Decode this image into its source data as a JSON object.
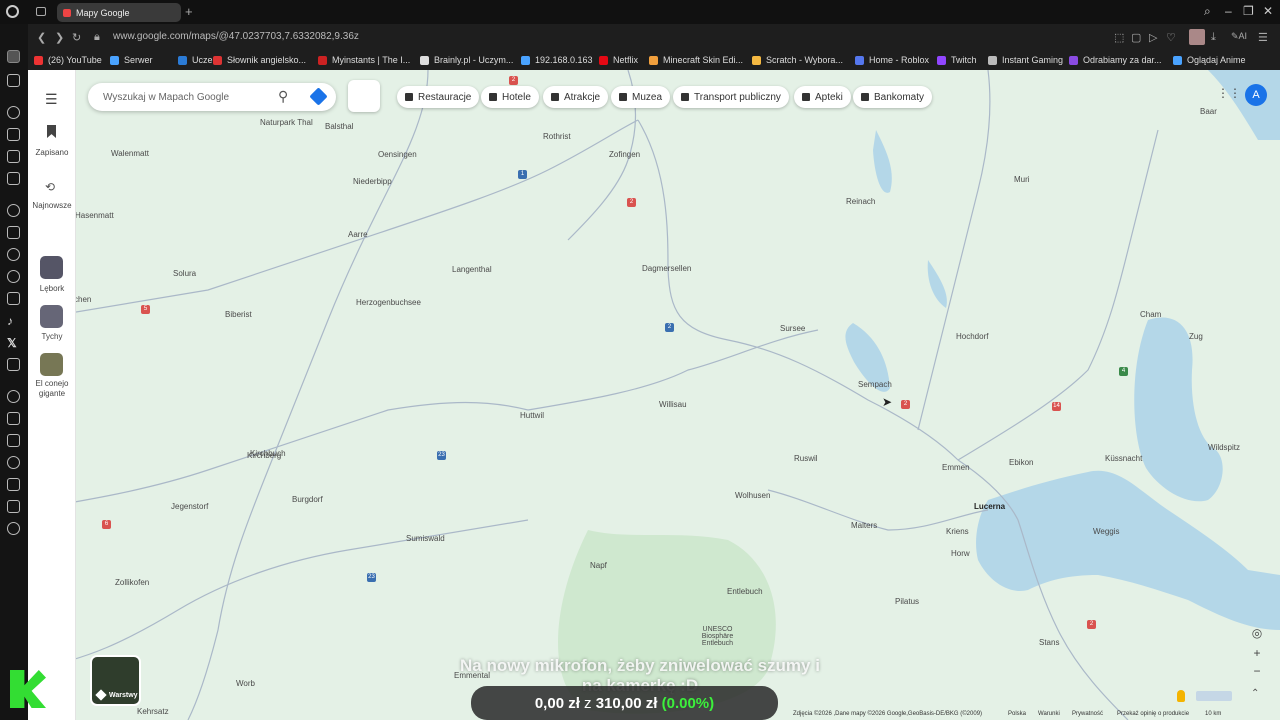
{
  "browser": {
    "tab_title": "Mapy Google",
    "url": "www.google.com/maps/@47.0237703,7.6332082,9.36z",
    "ai_label": "AI",
    "bookmarks": [
      {
        "label": "(26) YouTube",
        "color": "#e33"
      },
      {
        "label": "Serwer",
        "color": "#4aa3ff"
      },
      {
        "label": "Uczeń",
        "color": "#2b7bd6"
      },
      {
        "label": "Słownik angielsko...",
        "color": "#d33"
      },
      {
        "label": "Myinstants | The I...",
        "color": "#c22"
      },
      {
        "label": "Brainly.pl - Uczym...",
        "color": "#ddd"
      },
      {
        "label": "192.168.0.163",
        "color": "#4aa3ff"
      },
      {
        "label": "Netflix",
        "color": "#e50914"
      },
      {
        "label": "Minecraft Skin Edi...",
        "color": "#f2a03d"
      },
      {
        "label": "Scratch - Wybora...",
        "color": "#f5b942"
      },
      {
        "label": "Home - Roblox",
        "color": "#5577ee"
      },
      {
        "label": "Twitch",
        "color": "#9146ff"
      },
      {
        "label": "Instant Gaming",
        "color": "#bbb"
      },
      {
        "label": "Odrabiamy za dar...",
        "color": "#8a4be2"
      },
      {
        "label": "Oglądaj Anime",
        "color": "#4aa3ff"
      }
    ]
  },
  "maps": {
    "search_placeholder": "Wyszukaj w Mapach Google",
    "sidebar": {
      "saved": "Zapisano",
      "recent": "Najnowsze",
      "recent_places": [
        "Lębork",
        "Tychy",
        "El conejo gigante"
      ]
    },
    "chips": [
      "Restauracje",
      "Hotele",
      "Atrakcje",
      "Muzea",
      "Transport publiczny",
      "Apteki",
      "Bankomaty"
    ],
    "avatar_letter": "A",
    "layers_label": "Warstwy",
    "places": [
      {
        "name": "Naturpark Thal"
      },
      {
        "name": "Balsthal"
      },
      {
        "name": "Rothrist"
      },
      {
        "name": "Zofingen"
      },
      {
        "name": "Oensingen"
      },
      {
        "name": "Niederbipp"
      },
      {
        "name": "Walenmatt"
      },
      {
        "name": "Hasenmatt"
      },
      {
        "name": "Aarre"
      },
      {
        "name": "Langenthal"
      },
      {
        "name": "Dagmersellen"
      },
      {
        "name": "Reinach"
      },
      {
        "name": "Muri"
      },
      {
        "name": "Baar"
      },
      {
        "name": "Cham"
      },
      {
        "name": "Zug"
      },
      {
        "name": "Solura"
      },
      {
        "name": "Herzogenbuchsee"
      },
      {
        "name": "Biberist"
      },
      {
        "name": "Sursee"
      },
      {
        "name": "Hochdorf"
      },
      {
        "name": "Sempach"
      },
      {
        "name": "Huttwil"
      },
      {
        "name": "Willisau"
      },
      {
        "name": "Kirchberg"
      },
      {
        "name": "Ruswil"
      },
      {
        "name": "Emmen"
      },
      {
        "name": "Ebikon"
      },
      {
        "name": "Küssnacht"
      },
      {
        "name": "Wildspitz"
      },
      {
        "name": "Burgdorf"
      },
      {
        "name": "Wolhusen"
      },
      {
        "name": "Jegenstorf"
      },
      {
        "name": "Malters"
      },
      {
        "name": "Kriens"
      },
      {
        "name": "Sumiswald"
      },
      {
        "name": "Weggis"
      },
      {
        "name": "Napf"
      },
      {
        "name": "Horw"
      },
      {
        "name": "Zollikofen"
      },
      {
        "name": "Entlebuch"
      },
      {
        "name": "Pilatus"
      },
      {
        "name": "UNESCO Biosphäre Entlebuch"
      },
      {
        "name": "Stans"
      },
      {
        "name": "Emmental"
      },
      {
        "name": "Worb"
      },
      {
        "name": "Kehrsatz"
      },
      {
        "name": "chen"
      },
      {
        "name": "Kirchbuch"
      }
    ],
    "cities": [
      {
        "name": "Lucerna"
      }
    ],
    "footer": [
      "Zdjęcia ©2026 ,Dane mapy ©2026 Google,GeoBasis-DE/BKG (©2009)",
      "Polska",
      "Warunki",
      "Prywatność",
      "Przekaż opinię o produkcie",
      "10 km"
    ]
  },
  "overlay": {
    "caption_line1": "Na nowy mikrofon, żeby zniwelować szumy i",
    "caption_line2": "na kamerkę :D",
    "donation_amount": "0,00 zł",
    "donation_sep": "z",
    "donation_goal": "310,00 zł",
    "donation_pct": "(0.00%)"
  }
}
